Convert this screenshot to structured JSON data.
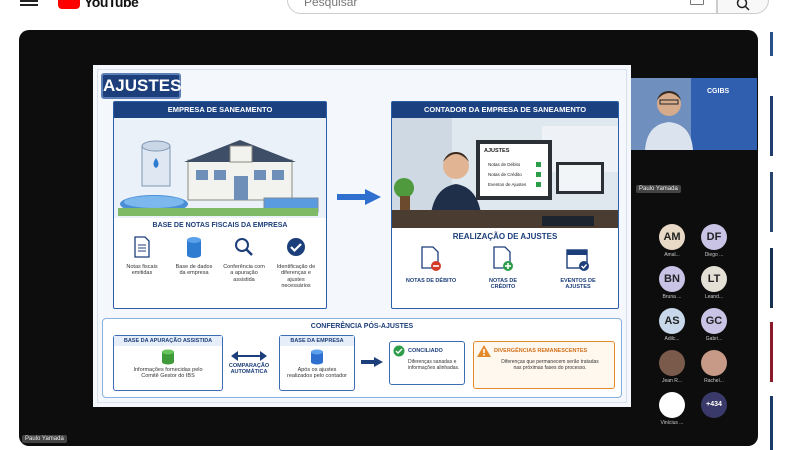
{
  "header": {
    "logo_text": "YouTube",
    "search_placeholder": "Pesquisar"
  },
  "slide": {
    "title": "AJUSTES",
    "left_panel": {
      "heading": "EMPRESA DE SANEAMENTO",
      "subheading": "BASE DE NOTAS FISCAIS DA EMPRESA",
      "items": [
        {
          "label": "Notas fiscais emitidas",
          "icon": "document-icon"
        },
        {
          "label": "Base de dados da empresa",
          "icon": "database-icon"
        },
        {
          "label": "Conferência com a apuração assistida",
          "icon": "magnifier-icon"
        },
        {
          "label": "Identificação de diferenças e ajustes necessários",
          "icon": "check-circle-icon"
        }
      ]
    },
    "right_panel": {
      "heading": "CONTADOR DA EMPRESA DE SANEAMENTO",
      "screen_title": "AJUSTES",
      "screen_items": [
        "Notas de Débito",
        "Notas de Crédito",
        "Eventos de Ajustes"
      ],
      "subheading": "REALIZAÇÃO DE AJUSTES",
      "items": [
        {
          "label": "NOTAS DE DÉBITO",
          "icon": "document-minus-icon"
        },
        {
          "label": "NOTAS DE CRÉDITO",
          "icon": "document-plus-icon"
        },
        {
          "label": "EVENTOS DE AJUSTES",
          "icon": "calendar-check-icon"
        }
      ]
    },
    "bottom": {
      "heading": "CONFERÊNCIA PÓS-AJUSTES",
      "box1_title": "BASE DA APURAÇÃO ASSISTIDA",
      "box1_text": "Informações fornecidas pelo Comitê Gestor do IBS",
      "compare_text": "COMPARAÇÃO AUTOMÁTICA",
      "box2_title": "BASE DA EMPRESA",
      "box2_text": "Após os ajustes realizados pelo contador",
      "box3_title": "CONCILIADO",
      "box3_text": "Diferenças sanadas e informações alinhadas.",
      "box4_title": "DIVERGÊNCIAS REMANESCENTES",
      "box4_text": "Diferenças que permanecem serão tratadas nas próximas fases do processo."
    }
  },
  "presenter": {
    "name": "Paulo Yamada",
    "brand": "CGIBS"
  },
  "participants": [
    {
      "initials": "AM",
      "name": "Amal...",
      "color": "#e8d9c6"
    },
    {
      "initials": "DF",
      "name": "Diego ...",
      "color": "#c9c3e6"
    },
    {
      "initials": "BN",
      "name": "Bruna ...",
      "color": "#c9c3e6"
    },
    {
      "initials": "LT",
      "name": "Leand...",
      "color": "#e4e0d6"
    },
    {
      "initials": "AS",
      "name": "Adilc...",
      "color": "#c8d8ea"
    },
    {
      "initials": "GC",
      "name": "Gabri...",
      "color": "#c9c3e6"
    },
    {
      "initials": "",
      "name": "Jean R...",
      "color": "#7a5a4a"
    },
    {
      "initials": "",
      "name": "Rachel...",
      "color": "#c69a86"
    },
    {
      "initials": "",
      "name": "Vinícius ...",
      "color": "#ffffff"
    },
    {
      "initials": "+434",
      "name": "",
      "color": "#3a3a6a"
    }
  ],
  "bottom_label": "Paulo Yamada"
}
